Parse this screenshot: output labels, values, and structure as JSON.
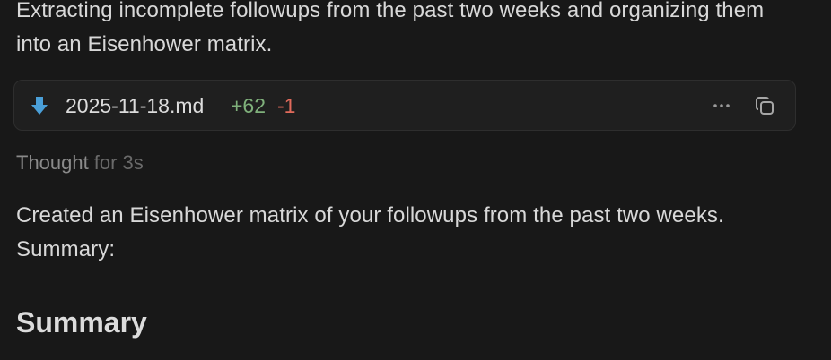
{
  "intro_text": "Extracting incomplete followups from the past two weeks and organizing them into an Eisenhower matrix.",
  "file_card": {
    "icon": "download-arrow-icon",
    "filename": "2025-11-18.md",
    "additions": "+62",
    "deletions": "-1",
    "more_icon": "more-horizontal-icon",
    "copy_icon": "copy-icon",
    "colors": {
      "additions": "#7fb07b",
      "deletions": "#e06a5b",
      "icon": "#4a9fd8"
    }
  },
  "thought": {
    "label": "Thought",
    "duration": "for 3s"
  },
  "result_text": "Created an Eisenhower matrix of your followups from the past two weeks. Summary:",
  "summary_heading": "Summary"
}
